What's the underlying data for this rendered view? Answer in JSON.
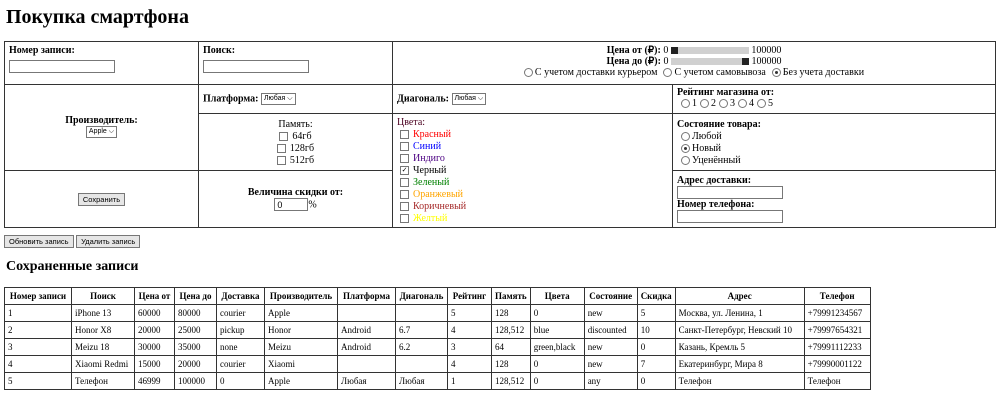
{
  "title": "Покупка смартфона",
  "record_label": "Номер записи:",
  "record_value": "",
  "search_label": "Поиск:",
  "search_value": "",
  "price_from_label": "Цена от (₽):",
  "price_from_min": "0",
  "price_from_max": "100000",
  "price_from_value": 0,
  "price_to_label": "Цена до (₽):",
  "price_to_min": "0",
  "price_to_max": "100000",
  "price_to_value": 100000,
  "delivery": [
    {
      "label": "С учетом доставки курьером",
      "checked": false
    },
    {
      "label": "С учетом самовывоза",
      "checked": false
    },
    {
      "label": "Без учета доставки",
      "checked": true
    }
  ],
  "manufacturer_label": "Производитель:",
  "manufacturer_value": "Apple",
  "platform_label": "Платформа:",
  "platform_value": "Любая",
  "diagonal_label": "Диагональ:",
  "diagonal_value": "Любая",
  "rating_label": "Рейтинг магазина от:",
  "ratings": [
    "1",
    "2",
    "3",
    "4",
    "5"
  ],
  "memory_label": "Память:",
  "memory": [
    "64гб",
    "128гб",
    "512гб"
  ],
  "colors_label": "Цвета:",
  "colors": [
    {
      "label": "Красный",
      "color": "#ff0000",
      "checked": false
    },
    {
      "label": "Синий",
      "color": "#0000ff",
      "checked": false
    },
    {
      "label": "Индиго",
      "color": "#4b0082",
      "checked": false
    },
    {
      "label": "Черный",
      "color": "#000000",
      "checked": true
    },
    {
      "label": "Зеленый",
      "color": "#008000",
      "checked": false
    },
    {
      "label": "Оранжевый",
      "color": "#ffa500",
      "checked": false
    },
    {
      "label": "Коричневый",
      "color": "#a52a2a",
      "checked": false
    },
    {
      "label": "Желтый",
      "color": "#ffff00",
      "checked": false
    }
  ],
  "condition_label": "Состояние товара:",
  "conditions": [
    {
      "label": "Любой",
      "checked": false
    },
    {
      "label": "Новый",
      "checked": true
    },
    {
      "label": "Уценённый",
      "checked": false
    }
  ],
  "save_label": "Сохранить",
  "discount_label": "Величина скидки от:",
  "discount_value": "0",
  "discount_unit": "%",
  "address_label": "Адрес доставки:",
  "address_value": "",
  "phone_label": "Номер телефона:",
  "phone_value": "",
  "update_label": "Обновить запись",
  "delete_label": "Удалить запись",
  "saved_title": "Сохраненные записи",
  "table": {
    "headers": [
      "Номер записи",
      "Поиск",
      "Цена от",
      "Цена до",
      "Доставка",
      "Производитель",
      "Платформа",
      "Диагональ",
      "Рейтинг",
      "Память",
      "Цвета",
      "Состояние",
      "Скидка",
      "Адрес",
      "Телефон"
    ],
    "rows": [
      [
        "1",
        "iPhone 13",
        "60000",
        "80000",
        "courier",
        "Apple",
        "",
        "",
        "5",
        "128",
        "0",
        "new",
        "5",
        "Москва, ул. Ленина, 1",
        "+79991234567"
      ],
      [
        "2",
        "Honor X8",
        "20000",
        "25000",
        "pickup",
        "Honor",
        "Android",
        "6.7",
        "4",
        "128,512",
        "blue",
        "discounted",
        "10",
        "Санкт-Петербург, Невский 10",
        "+79997654321"
      ],
      [
        "3",
        "Meizu 18",
        "30000",
        "35000",
        "none",
        "Meizu",
        "Android",
        "6.2",
        "3",
        "64",
        "green,black",
        "new",
        "0",
        "Казань, Кремль 5",
        "+79991112233"
      ],
      [
        "4",
        "Xiaomi Redmi",
        "15000",
        "20000",
        "courier",
        "Xiaomi",
        "",
        "",
        "4",
        "128",
        "0",
        "new",
        "7",
        "Екатеринбург, Мира 8",
        "+79990001122"
      ],
      [
        "5",
        "Телефон",
        "46999",
        "100000",
        "0",
        "Apple",
        "Любая",
        "Любая",
        "1",
        "128,512",
        "0",
        "any",
        "0",
        "Телефон",
        "Телефон"
      ]
    ]
  }
}
